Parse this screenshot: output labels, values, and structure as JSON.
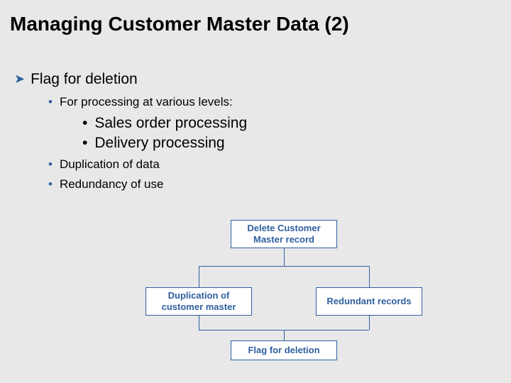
{
  "title": "Managing Customer Master Data (2)",
  "bullet1": {
    "text": "Flag for deletion",
    "sub1": "For processing at various levels:",
    "sub2a": "Sales order processing",
    "sub2b": "Delivery processing",
    "sub3": "Duplication of data",
    "sub4": "Redundancy of use"
  },
  "diagram": {
    "top": "Delete Customer Master record",
    "left": "Duplication of customer master",
    "right": "Redundant records",
    "bottom": "Flag for deletion"
  }
}
